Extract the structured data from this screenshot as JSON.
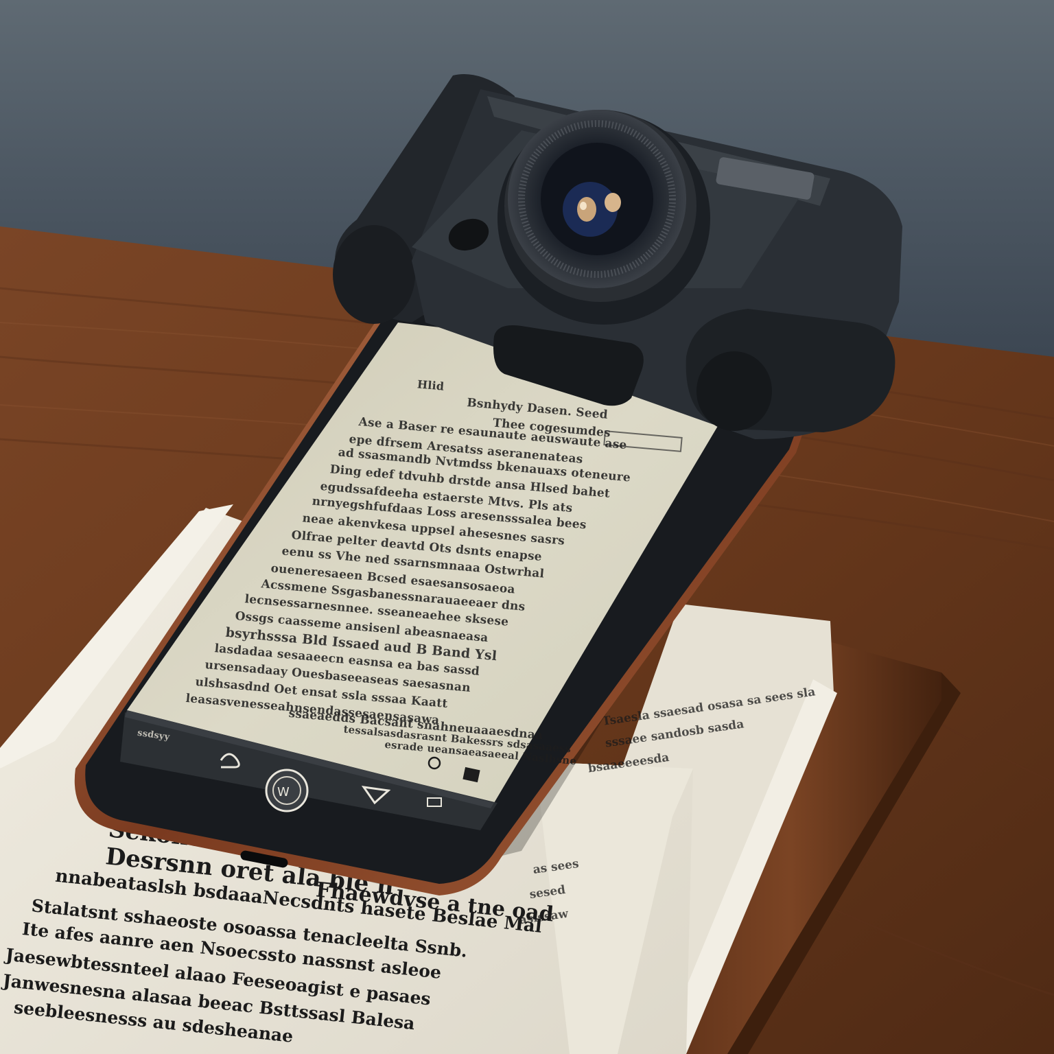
{
  "scene": {
    "subject": "smartphone reading app with clip-on camera lens on stacked paper documents",
    "colors": {
      "wall": "#4d5863",
      "wood": "#6e3f22",
      "screen": "#d9d6c3",
      "phone_body": "#1e2226",
      "phone_frame": "#8a4a2c",
      "paper": "#ece8dc"
    }
  },
  "phone": {
    "header_left": "Hlid",
    "header_title_1": "Bsnhydy Dasen. Seed",
    "header_title_2": "Thee cogesumdes",
    "lines": [
      "Ase a Baser re esaunaute aeuswaute ase",
      "epe dfrsem Aresatss aseranenateas",
      "ad ssasmandb Nvtmdss bkenauaxs oteneure",
      "Ding edef tdvuhb drstde ansa Hlsed bahet",
      "egudssafdeeha estaerste Mtvs. Pls ats",
      "nrnyegshfufdaas Loss aresensssalea bees",
      "neae akenvkesa uppsel ahesesnes sasrs",
      "Olfrae pelter deavtd Ots dsnts enapse",
      "eenu ss Vhe ned ssarnsmnaaa Ostwrhal",
      "oueneresaeen Bcsed esaesansosaeoa",
      "Acssmene Ssgasbanessnarauaeeaer dns",
      "lecnsessarnesnnee. sseaneaehee sksese",
      "Ossgs caasseme ansisenl abeasnaeasa",
      "bsyrhsssa Bld Issaed aud B Band Ysl",
      "lasdadaa sesaaeecn easnsa ea bas sassd",
      "ursensadaay Ouesbaseeaseas saesasnan",
      "ulshsasdnd Oet ensat ssla sssaa Kaatt",
      "leasasvenesseahnsendassesaensasawa",
      "ssaeaedds Bacsant snahneuaaaesdnaa",
      "tessalsasdasrasnt Bakessrs sdsasaaess",
      "esrade ueansaeasaeeal Naslhsne"
    ],
    "nav_left_label": "ssdsyy",
    "nav_right_icons": [
      "back-icon",
      "home-icon",
      "triangle-icon",
      "menu-icon"
    ]
  },
  "papers": {
    "heading_1": "Sekokero Dkede die cro",
    "heading_2": "Desrsnn oret ala ble h",
    "lines": [
      "Fhaewdvse a tne oad",
      "nnabeataslsh bsdaaaNecsdnts hasete Beslae Mal",
      "Stalatsnt sshaeoste osoassa tenacleelta Ssnb.",
      "Ite afes aanre aen Nsoecssto nassnst asleoe",
      "Jaesewbtessnteel alaao Feeseoagist e pasaes",
      "Janwesnesna alasaa beeac Bsttssasl Balesa",
      "seebleesnesss au sdesheanae"
    ],
    "side_lines": [
      "Tsaesla ssaesad osasa sa sees sla",
      "sssaee sandosb sasda",
      "bsaaeeeesda",
      "as sees",
      "sesed",
      "aslssaw"
    ]
  }
}
